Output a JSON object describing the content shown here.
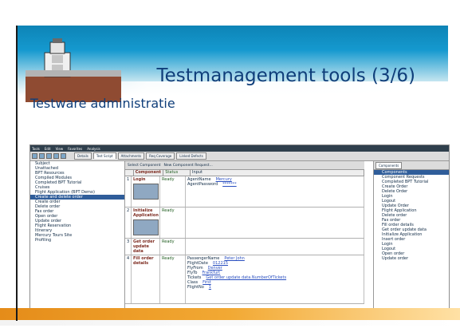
{
  "slide": {
    "title": "Testmanagement tools (3/6)",
    "subtitle": "Testware administratie"
  },
  "app": {
    "menu": [
      "Tools",
      "Edit",
      "View",
      "Favorites",
      "Analysis"
    ],
    "tabs": [
      "Details",
      "Test Script",
      "Attachments",
      "Req Coverage",
      "Linked Defects"
    ],
    "toolbar": {
      "select_component": "Select Component",
      "new_component_request": "New Component Request..."
    },
    "tree": [
      "Subject",
      "Unattached",
      "BPT Resources",
      "Compiled Modules",
      "Completed BPT Tutorial",
      "Cruises",
      "Flight Application (BPT Demo)",
      "Create and delete order",
      "Create order",
      "Delete order",
      "Fax order",
      "Open order",
      "Update order",
      "Flight Reservation",
      "Itinerary",
      "Mercury Tours Site",
      "Profiling"
    ],
    "table": {
      "headers": [
        "Component",
        "Status",
        "Input"
      ],
      "rows": [
        {
          "num": "1",
          "component": "Login",
          "status": "Ready",
          "inputs": [
            [
              "AgentName",
              "Mercury"
            ],
            [
              "AgentPassword",
              "*******"
            ]
          ]
        },
        {
          "num": "2",
          "component": "Initialize Application",
          "status": "Ready",
          "inputs": []
        },
        {
          "num": "3",
          "component": "Get order update data",
          "status": "Ready",
          "inputs": []
        },
        {
          "num": "4",
          "component": "Fill order details",
          "status": "Ready",
          "inputs": [
            [
              "PassengerName",
              "Peter John"
            ],
            [
              "FlightDate",
              "012215"
            ],
            [
              "FlyFrom",
              "Denver"
            ],
            [
              "FlyTo",
              "Frankfurt"
            ],
            [
              "Tickets",
              "Get order update data.NumberOfTickets"
            ],
            [
              "Class",
              "First"
            ],
            [
              "FlightNo",
              "1"
            ]
          ]
        }
      ]
    },
    "components": {
      "tab": "Components",
      "items": [
        "Components",
        "Component Requests",
        "Completed BPT Tutorial",
        "Create Order",
        "Delete Order",
        "Login",
        "Logout",
        "Update Order",
        "Flight Application",
        "Delete order",
        "Fax order",
        "Fill order details",
        "Get order update data",
        "Initialize Application",
        "Insert order",
        "Login",
        "Logout",
        "Open order",
        "Update order"
      ]
    }
  }
}
